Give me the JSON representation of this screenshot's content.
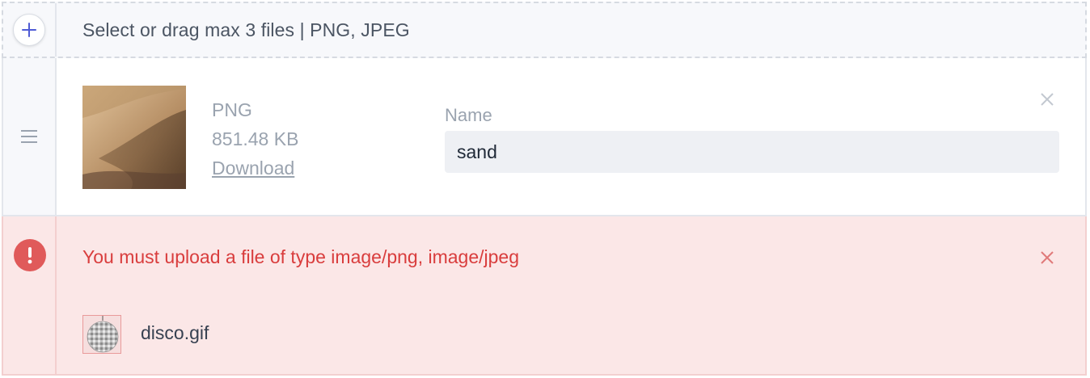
{
  "dropzone": {
    "add_icon": "plus-icon",
    "text": "Select or drag max 3 files | PNG, JPEG"
  },
  "file": {
    "drag_icon": "menu-icon",
    "type": "PNG",
    "size": "851.48 KB",
    "download_label": "Download",
    "name_label": "Name",
    "name_value": "sand",
    "remove_icon": "close-icon"
  },
  "error": {
    "icon": "exclamation-icon",
    "message": "You must upload a file of type image/png, image/jpeg",
    "close_icon": "close-icon",
    "file_name": "disco.gif"
  },
  "colors": {
    "accent": "#4f5bd5",
    "error_text": "#d93d3d",
    "error_bg": "#fbe7e7",
    "error_icon": "#e05a5a"
  }
}
